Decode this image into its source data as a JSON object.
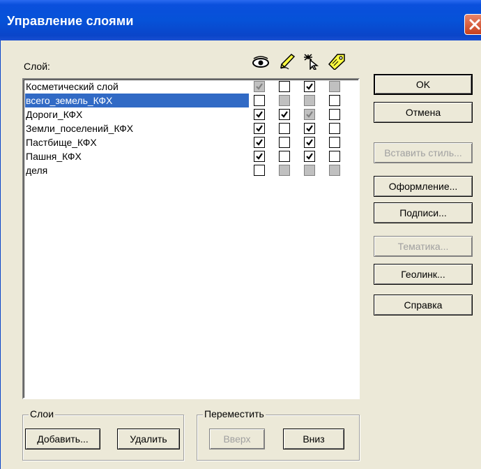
{
  "window": {
    "title": "Управление слоями"
  },
  "layers": {
    "header_label": "Слой:",
    "column_icons": [
      "eye-icon",
      "pencil-icon",
      "cursor-sparkle-icon",
      "tag-icon"
    ],
    "rows": [
      {
        "name": "Косметический слой",
        "selected": false,
        "checks": [
          "checked-gray",
          "unchecked",
          "checked",
          "gray"
        ]
      },
      {
        "name": "всего_земель_КФХ",
        "selected": true,
        "checks": [
          "unchecked",
          "gray",
          "gray",
          "unchecked"
        ]
      },
      {
        "name": "Дороги_КФХ",
        "selected": false,
        "checks": [
          "checked",
          "checked",
          "checked-gray",
          "unchecked"
        ]
      },
      {
        "name": "Земли_поселений_КФХ",
        "selected": false,
        "checks": [
          "checked",
          "unchecked",
          "checked",
          "unchecked"
        ]
      },
      {
        "name": "Пастбище_КФХ",
        "selected": false,
        "checks": [
          "checked",
          "unchecked",
          "checked",
          "unchecked"
        ]
      },
      {
        "name": "Пашня_КФХ",
        "selected": false,
        "checks": [
          "checked",
          "unchecked",
          "checked",
          "unchecked"
        ]
      },
      {
        "name": "деля",
        "selected": false,
        "checks": [
          "unchecked",
          "gray",
          "gray",
          "gray"
        ]
      }
    ]
  },
  "buttons": {
    "ok": "OK",
    "cancel": "Отмена",
    "insert_style": "Вставить стиль...",
    "appearance": "Оформление...",
    "labels": "Подписи...",
    "thematic": "Тематика...",
    "geolink": "Геолинк...",
    "help": "Справка"
  },
  "layers_group": {
    "title": "Слои",
    "add": "Добавить...",
    "delete": "Удалить"
  },
  "move_group": {
    "title": "Переместить",
    "up": "Вверх",
    "down": "Вниз"
  }
}
